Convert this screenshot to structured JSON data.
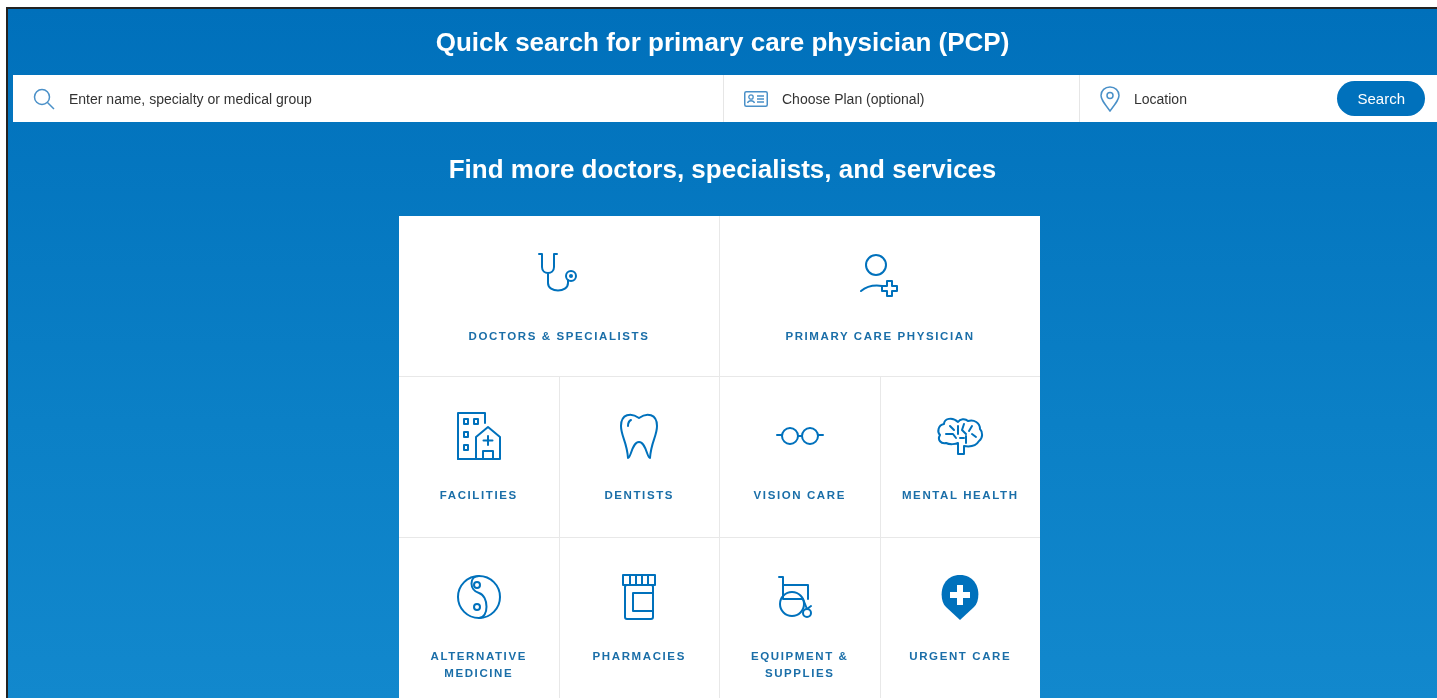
{
  "header": {
    "title": "Quick search for primary care physician (PCP)"
  },
  "search_bar": {
    "name_field": {
      "placeholder": "Enter name, specialty or medical group"
    },
    "plan_field": {
      "placeholder": "Choose Plan (optional)"
    },
    "location_field": {
      "placeholder": "Location"
    },
    "button": "Search"
  },
  "heading": "Find more doctors, specialists, and services",
  "tile_rows": [
    [
      {
        "kind": "stethoscope",
        "label": "DOCTORS & SPECIALISTS"
      },
      {
        "kind": "person-plus",
        "label": "PRIMARY CARE PHYSICIAN"
      }
    ],
    [
      {
        "kind": "building",
        "label": "FACILITIES"
      },
      {
        "kind": "tooth",
        "label": "DENTISTS"
      },
      {
        "kind": "glasses",
        "label": "VISION CARE"
      },
      {
        "kind": "brain",
        "label": "MENTAL HEALTH"
      }
    ],
    [
      {
        "kind": "yin-yang",
        "label": "ALTERNATIVE MEDICINE"
      },
      {
        "kind": "pill-bottle",
        "label": "PHARMACIES"
      },
      {
        "kind": "wheelchair",
        "label": "EQUIPMENT & SUPPLIES"
      },
      {
        "kind": "pin-cross",
        "label": "URGENT CARE"
      }
    ]
  ]
}
